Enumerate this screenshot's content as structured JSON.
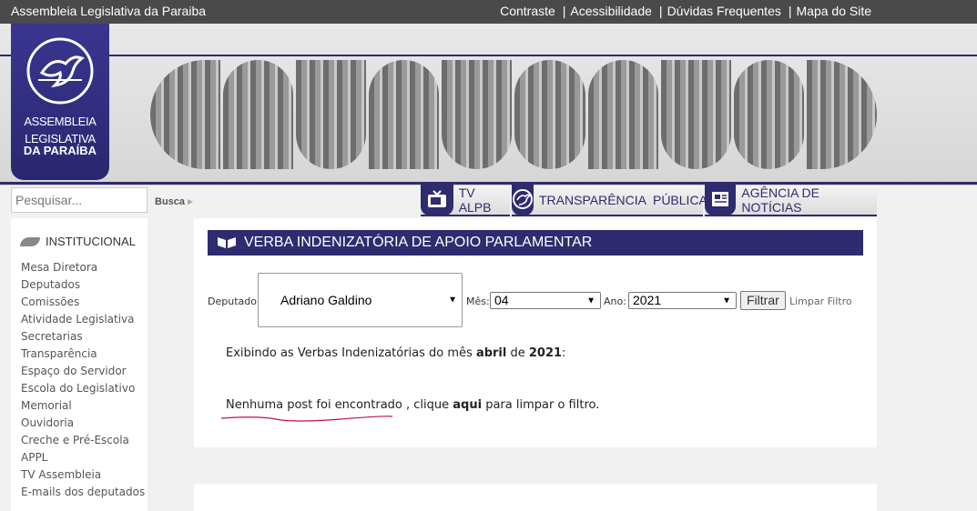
{
  "topbar": {
    "site_name": "Assembleia Legislativa da Paraiba",
    "links": [
      "Contraste",
      "Acessibilidade",
      "Dúvidas Frequentes",
      "Mapa do Site"
    ],
    "separator": "|"
  },
  "logo": {
    "line1": "ASSEMBLEIA",
    "line2": "LEGISLATIVA",
    "line3": "DA PARAÍBA"
  },
  "search": {
    "placeholder": "Pesquisar...",
    "button_label": "Busca"
  },
  "nav": {
    "tv": "TV ALPB",
    "transparencia": "TRANSPARÊNCIA  PÚBLICA",
    "noticias": "AGÊNCIA DE NOTÍCIAS"
  },
  "sidebar": {
    "title": "INSTITUCIONAL",
    "items": [
      "Mesa Diretora",
      "Deputados",
      "Comissões",
      "Atividade Legislativa",
      "Secretarias",
      "Transparência",
      "Espaço do Servidor",
      "Escola do Legislativo",
      "Memorial",
      "Ouvidoria",
      "Creche e Pré-Escola",
      "APPL",
      "TV Assembleia",
      "E-mails dos deputados"
    ]
  },
  "main": {
    "heading": "VERBA INDENIZATÓRIA DE APOIO PARLAMENTAR",
    "filter": {
      "deputado_label": "Deputado:",
      "deputado_value": "Adriano Galdino",
      "mes_label": "Mês:",
      "mes_value": "04",
      "ano_label": "Ano:",
      "ano_value": "2021",
      "filtrar_label": "Filtrar",
      "limpar_label": "Limpar Filtro"
    },
    "message": {
      "prefix": "Exibindo as Verbas Indenizatórias do mês ",
      "month": "abril",
      "middle": " de ",
      "year": "2021",
      "suffix": ":"
    },
    "empty": {
      "text": "Nenhuma post foi encontrado , clique ",
      "link": "aqui",
      "after": " para limpar o filtro."
    }
  },
  "colors": {
    "brand": "#2e2b6e",
    "topbar": "#4a4a4a",
    "squiggle": "#c0143c"
  }
}
